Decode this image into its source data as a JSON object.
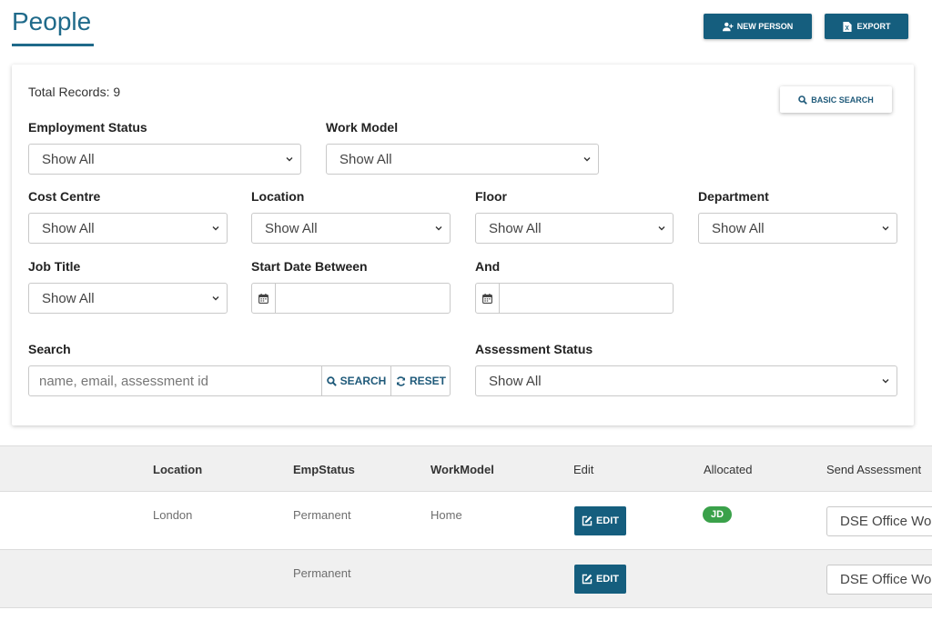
{
  "header": {
    "title": "People",
    "new_person_label": "NEW PERSON",
    "export_label": "EXPORT"
  },
  "filters": {
    "total_records": "Total Records: 9",
    "basic_search_label": "BASIC SEARCH",
    "employment_status": {
      "label": "Employment Status",
      "value": "Show All"
    },
    "work_model": {
      "label": "Work Model",
      "value": "Show All"
    },
    "cost_centre": {
      "label": "Cost Centre",
      "value": "Show All"
    },
    "location": {
      "label": "Location",
      "value": "Show All"
    },
    "floor": {
      "label": "Floor",
      "value": "Show All"
    },
    "department": {
      "label": "Department",
      "value": "Show All"
    },
    "job_title": {
      "label": "Job Title",
      "value": "Show All"
    },
    "start_date": {
      "label": "Start Date Between",
      "value": ""
    },
    "end_date": {
      "label": "And",
      "value": ""
    },
    "search": {
      "label": "Search",
      "placeholder": "name, email, assessment id",
      "search_button": "SEARCH",
      "reset_button": "RESET"
    },
    "assessment_status": {
      "label": "Assessment Status",
      "value": "Show All"
    }
  },
  "table": {
    "columns": [
      "Location",
      "EmpStatus",
      "WorkModel",
      "Edit",
      "Allocated",
      "Send Assessment"
    ],
    "rows": [
      {
        "location": "London",
        "emp_status": "Permanent",
        "work_model": "Home",
        "edit_label": "EDIT",
        "allocated": "JD",
        "send_assessment": "DSE Office Worker"
      },
      {
        "location": "",
        "emp_status": "Permanent",
        "work_model": "",
        "edit_label": "EDIT",
        "allocated": "",
        "send_assessment": "DSE Office Worker"
      }
    ]
  },
  "colors": {
    "primary": "#155e7e",
    "title": "#1f6a8a",
    "badge": "#3aa14a"
  }
}
